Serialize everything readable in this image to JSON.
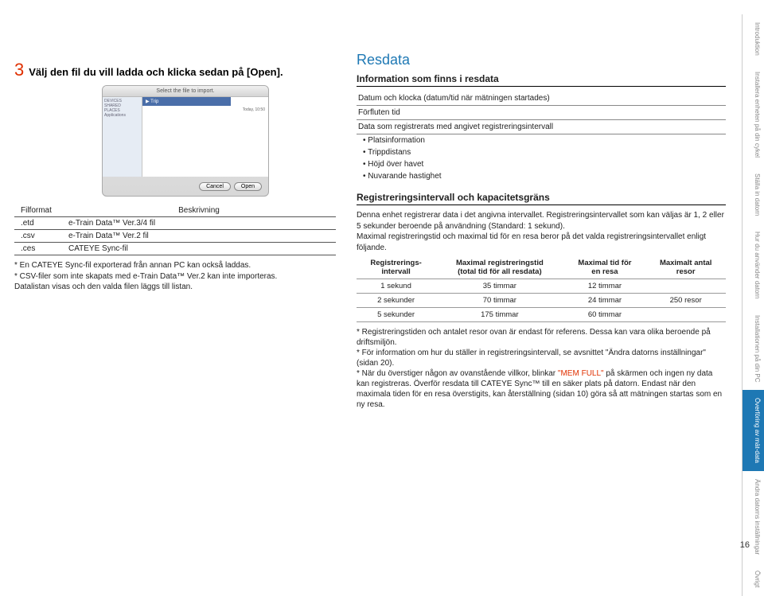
{
  "left": {
    "step_num": "3",
    "step_text": "Välj den fil du vill ladda och klicka sedan på [Open].",
    "dialog": {
      "title": "Select the file to import.",
      "sidebar": [
        "DEVICES",
        "SHARED",
        "PLACES",
        "Applications"
      ],
      "folder": "▶ Trip",
      "stamp": "Today, 10:50",
      "cancel": "Cancel",
      "open": "Open"
    },
    "table": {
      "h1": "Filformat",
      "h2": "Beskrivning",
      "rows": [
        [
          ".etd",
          "e-Train Data™ Ver.3/4 fil"
        ],
        [
          ".csv",
          "e-Train Data™ Ver.2 fil"
        ],
        [
          ".ces",
          "CATEYE Sync-fil"
        ]
      ]
    },
    "notes": [
      "* En CATEYE Sync-fil exporterad från annan PC kan också laddas.",
      "* CSV-filer som inte skapats med e-Train Data™ Ver.2 kan inte importeras.",
      "Datalistan visas och den valda filen läggs till listan."
    ]
  },
  "right": {
    "title": "Resdata",
    "info_heading": "Information som finns i resdata",
    "info_rows": [
      "Datum och klocka (datum/tid när mätningen startades)",
      "Förfluten tid",
      "Data som registrerats med angivet registreringsintervall"
    ],
    "info_bullets": [
      "• Platsinformation",
      "• Trippdistans",
      "• Höjd över havet",
      "• Nuvarande hastighet"
    ],
    "reg_heading": "Registreringsintervall och kapacitetsgräns",
    "reg_intro": "Denna enhet registrerar data i det angivna intervallet. Registreringsintervallet som kan väljas är 1, 2 eller 5 sekunder beroende på användning (Standard: 1 sekund).\nMaximal registreringstid och maximal tid för en resa beror på det valda registreringsintervallet enligt följande.",
    "reg_table": {
      "h1": "Registrerings-\nintervall",
      "h2": "Maximal registreringstid\n(total tid för all resdata)",
      "h3": "Maximal tid för\nen resa",
      "h4": "Maximalt antal\nresor",
      "rows": [
        [
          "1 sekund",
          "35 timmar",
          "12 timmar",
          ""
        ],
        [
          "2 sekunder",
          "70 timmar",
          "24 timmar",
          "250 resor"
        ],
        [
          "5 sekunder",
          "175 timmar",
          "60 timmar",
          ""
        ]
      ]
    },
    "footnotes": [
      "* Registreringstiden och antalet resor ovan är endast för referens. Dessa kan vara olika beroende på driftsmiljön.",
      "* För information om hur du ställer in registreringsintervall, se avsnittet \"Ändra datorns inställningar\" (sidan 20).",
      {
        "pre": "* När du överstiger någon av ovanstående villkor, blinkar ",
        "red": "\"MEM FULL\"",
        "post": " på skärmen och ingen ny data kan registreras. Överför resdata till CATEYE Sync™ till en säker plats på datorn. Endast när den maximala tiden för en resa överstigits, kan återställning (sidan 10) göra så att mätningen startas som en ny resa."
      }
    ]
  },
  "tabs": [
    "Introduktion",
    "Installera enheten på din cykel",
    "Ställa in datorn",
    "Hur du använder datorn",
    "Installationen på din PC",
    "Överföring av mät-data",
    "Ändra datorns inställningar",
    "Övrigt"
  ],
  "active_tab": 5,
  "page_no": "16"
}
